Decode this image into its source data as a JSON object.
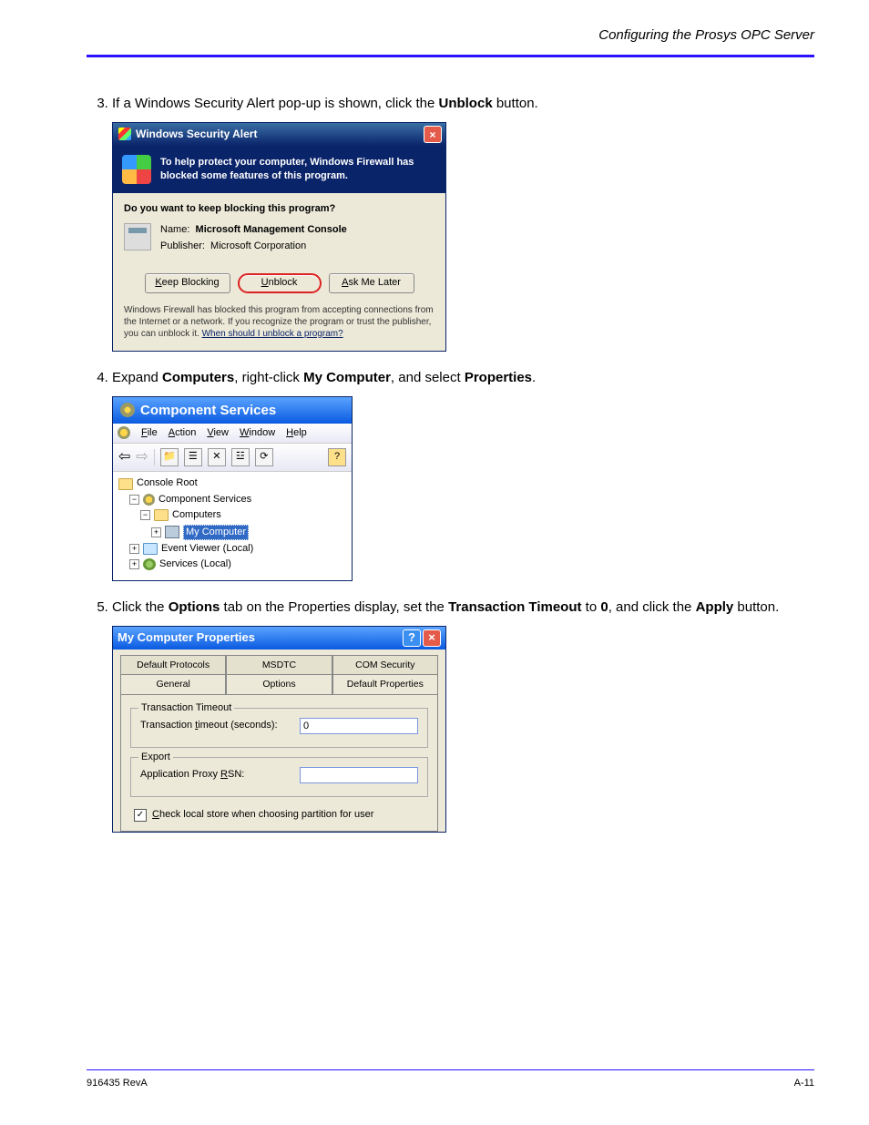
{
  "header_right": "Configuring the Prosys OPC Server",
  "steps": {
    "s3": {
      "before": "If a Windows Security Alert pop-up is shown, click the ",
      "bold": "Unblock",
      "after": " button."
    },
    "s4": {
      "t1": "Expand ",
      "b1": "Computers",
      "t2": ", right-click ",
      "b2": "My Computer",
      "t3": ", and select ",
      "b3": "Properties",
      "t4": "."
    },
    "s5": {
      "t1": "Click the ",
      "b1": "Options",
      "t2": " tab on the Properties display, set the ",
      "b2": "Transaction Timeout",
      "t3": " to ",
      "b3": "0",
      "t4": ", and click the ",
      "b4": "Apply",
      "t5": " button."
    }
  },
  "wsa": {
    "title": "Windows Security Alert",
    "blue_msg": "To help protect your computer, Windows Firewall has blocked some features of this program.",
    "question": "Do you want to keep blocking this program?",
    "name_label": "Name:",
    "name_value": "Microsoft Management Console",
    "pub_label": "Publisher:",
    "pub_value": "Microsoft Corporation",
    "btn_keep": "Keep Blocking",
    "btn_unblock": "Unblock",
    "btn_ask": "Ask Me Later",
    "foot1": "Windows Firewall has blocked this program from accepting connections from the Internet or a network. If you recognize the program or trust the publisher, you can unblock it. ",
    "foot_link": "When should I unblock a program?"
  },
  "cs": {
    "title": "Component Services",
    "menu": {
      "file": "File",
      "action": "Action",
      "view": "View",
      "window": "Window",
      "help": "Help"
    },
    "tree": {
      "root": "Console Root",
      "comp_services": "Component Services",
      "computers": "Computers",
      "mycomputer": "My Computer",
      "eventviewer": "Event Viewer (Local)",
      "services": "Services (Local)"
    }
  },
  "mcp": {
    "title": "My Computer Properties",
    "tabs_row1": {
      "a": "Default Protocols",
      "b": "MSDTC",
      "c": "COM Security"
    },
    "tabs_row2": {
      "a": "General",
      "b": "Options",
      "c": "Default Properties"
    },
    "grp1_title": "Transaction Timeout",
    "grp1_label": "Transaction timeout (seconds):",
    "grp1_value": "0",
    "grp2_title": "Export",
    "grp2_label": "Application Proxy RSN:",
    "grp2_value": "",
    "check_label": "Check local store when choosing partition for user"
  },
  "footer": {
    "left": "916435 RevA",
    "right": "A-11"
  }
}
